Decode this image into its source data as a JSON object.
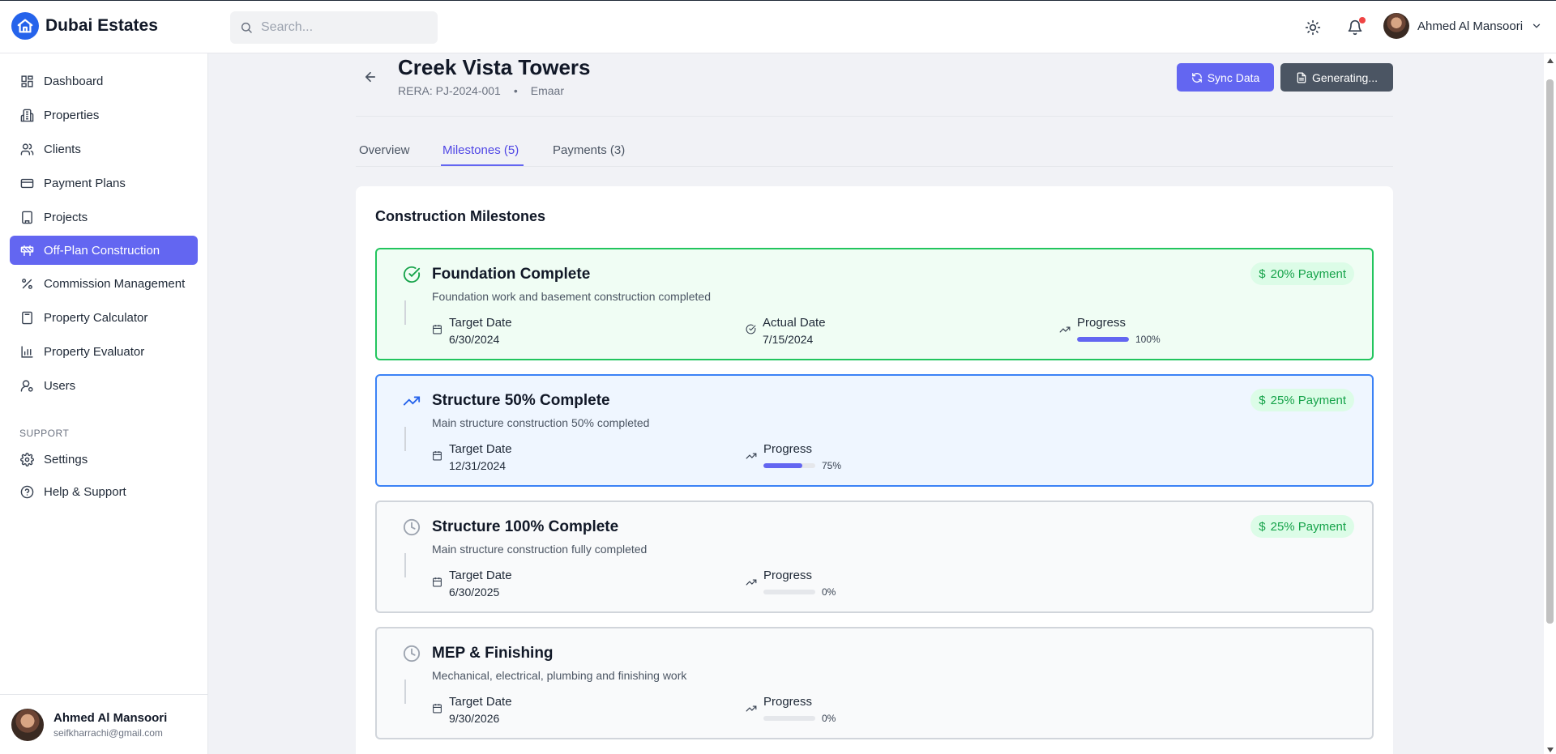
{
  "brand": {
    "name": "Dubai Estates"
  },
  "search": {
    "placeholder": "Search..."
  },
  "header": {
    "user_name": "Ahmed Al Mansoori"
  },
  "sidebar": {
    "items": [
      {
        "label": "Dashboard",
        "icon": "dashboard-icon"
      },
      {
        "label": "Properties",
        "icon": "building-icon"
      },
      {
        "label": "Clients",
        "icon": "users-icon"
      },
      {
        "label": "Payment Plans",
        "icon": "credit-card-icon"
      },
      {
        "label": "Projects",
        "icon": "office-building-icon"
      },
      {
        "label": "Off-Plan Construction",
        "icon": "construction-icon",
        "active": true
      },
      {
        "label": "Commission Management",
        "icon": "percent-icon"
      },
      {
        "label": "Property Calculator",
        "icon": "calculator-icon"
      },
      {
        "label": "Property Evaluator",
        "icon": "bar-chart-icon"
      },
      {
        "label": "Users",
        "icon": "user-cog-icon"
      }
    ],
    "support_label": "SUPPORT",
    "support_items": [
      {
        "label": "Settings",
        "icon": "gear-icon"
      },
      {
        "label": "Help & Support",
        "icon": "help-circle-icon"
      }
    ],
    "footer": {
      "name": "Ahmed Al Mansoori",
      "email": "seifkharrachi@gmail.com"
    }
  },
  "project": {
    "title": "Creek Vista Towers",
    "rera": "RERA: PJ-2024-001",
    "separator": "•",
    "developer": "Emaar",
    "sync_label": "Sync Data",
    "generating_label": "Generating..."
  },
  "tabs": [
    {
      "label": "Overview"
    },
    {
      "label": "Milestones (5)",
      "active": true
    },
    {
      "label": "Payments (3)"
    }
  ],
  "milestones_section": {
    "title": "Construction Milestones",
    "target_label": "Target Date",
    "actual_label": "Actual Date",
    "progress_label": "Progress",
    "items": [
      {
        "title": "Foundation Complete",
        "description": "Foundation work and basement construction completed",
        "payment": "20% Payment",
        "target_date": "6/30/2024",
        "actual_date": "7/15/2024",
        "progress": 100,
        "progress_text": "100%",
        "status": "completed"
      },
      {
        "title": "Structure 50% Complete",
        "description": "Main structure construction 50% completed",
        "payment": "25% Payment",
        "target_date": "12/31/2024",
        "progress": 75,
        "progress_text": "75%",
        "status": "in-progress"
      },
      {
        "title": "Structure 100% Complete",
        "description": "Main structure construction fully completed",
        "payment": "25% Payment",
        "target_date": "6/30/2025",
        "progress": 0,
        "progress_text": "0%",
        "status": "pending"
      },
      {
        "title": "MEP & Finishing",
        "description": "Mechanical, electrical, plumbing and finishing work",
        "target_date": "9/30/2026",
        "progress": 0,
        "progress_text": "0%",
        "status": "pending"
      }
    ]
  },
  "colors": {
    "accent": "#6366f1",
    "success": "#22c55e",
    "active_border": "#3b82f6",
    "notification": "#ef4444"
  }
}
